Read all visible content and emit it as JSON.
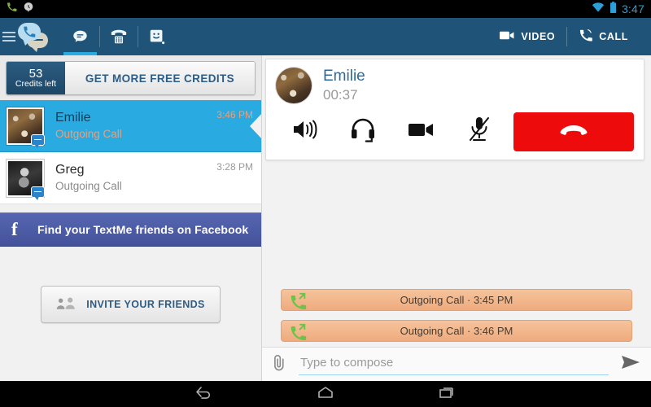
{
  "statusbar": {
    "time": "3:47",
    "icons": [
      "phone-call-icon",
      "hangouts-icon",
      "wifi-icon",
      "battery-icon"
    ]
  },
  "appbar": {
    "menu_icon": "hamburger-menu-icon",
    "logo_icon": "textme-logo-icon",
    "tabs": [
      {
        "name": "tab-messages",
        "icon": "chat-bubble-icon",
        "active": true
      },
      {
        "name": "tab-dialer",
        "icon": "dialpad-phone-icon",
        "active": false
      },
      {
        "name": "tab-stickers",
        "icon": "smiley-sticker-icon",
        "active": false
      }
    ],
    "actions": [
      {
        "label": "VIDEO",
        "icon": "video-camera-icon"
      },
      {
        "label": "CALL",
        "icon": "phone-call-icon"
      }
    ],
    "accent_color": "#29abe2",
    "bar_color": "#1f5377"
  },
  "sidebar": {
    "credits": {
      "count": "53",
      "count_label": "Credits left",
      "cta_label": "GET MORE FREE CREDITS"
    },
    "conversations": [
      {
        "name": "Emilie",
        "subtitle": "Outgoing Call",
        "time": "3:46 PM",
        "selected": true,
        "badge_icon": "chat-bubble-badge-icon"
      },
      {
        "name": "Greg",
        "subtitle": "Outgoing Call",
        "time": "3:28 PM",
        "selected": false,
        "badge_icon": "chat-bubble-badge-icon"
      }
    ],
    "facebook_banner": {
      "label": "Find your TextMe friends on Facebook",
      "icon": "facebook-f-icon",
      "color": "#4a5aa5"
    },
    "invite": {
      "label": "INVITE YOUR FRIENDS",
      "icon": "people-group-icon"
    }
  },
  "main": {
    "call": {
      "contact_name": "Emilie",
      "duration": "00:37",
      "avatar_icon": "contact-avatar",
      "controls": [
        {
          "name": "speaker-button",
          "icon": "speaker-icon"
        },
        {
          "name": "headset-button",
          "icon": "headset-icon"
        },
        {
          "name": "video-button",
          "icon": "video-camera-icon"
        },
        {
          "name": "mute-button",
          "icon": "microphone-muted-icon"
        }
      ],
      "end_call": {
        "name": "end-call-button",
        "icon": "hangup-phone-icon",
        "color": "#ee0b0b"
      }
    },
    "call_log": [
      {
        "text": "Outgoing Call · 3:45 PM",
        "icon": "outgoing-call-icon"
      },
      {
        "text": "Outgoing Call · 3:46 PM",
        "icon": "outgoing-call-icon"
      }
    ],
    "composer": {
      "attach_icon": "paperclip-icon",
      "placeholder": "Type to compose",
      "value": "",
      "send_icon": "send-arrow-icon"
    }
  },
  "navbar": {
    "buttons": [
      {
        "name": "nav-back-button",
        "icon": "back-arrow-icon"
      },
      {
        "name": "nav-home-button",
        "icon": "home-icon"
      },
      {
        "name": "nav-recents-button",
        "icon": "recents-icon"
      }
    ]
  }
}
